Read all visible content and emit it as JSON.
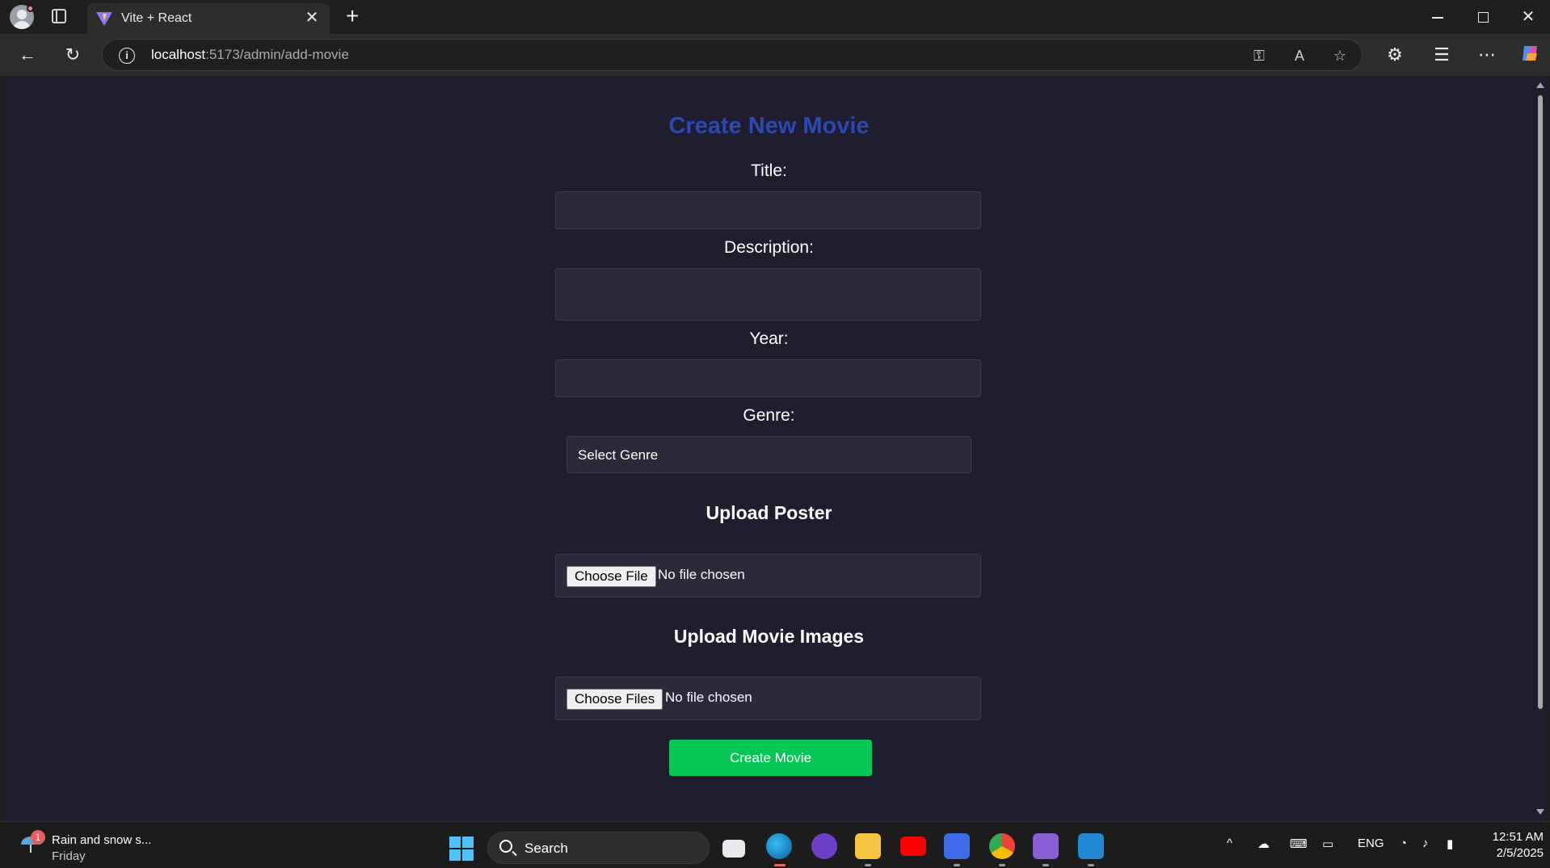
{
  "browser": {
    "tab_title": "Vite + React",
    "new_tab_symbol": "+",
    "address_host": "localhost",
    "address_path": ":5173/admin/add-movie"
  },
  "page": {
    "title": "Create New Movie",
    "labels": {
      "title": "Title:",
      "description": "Description:",
      "year": "Year:",
      "genre": "Genre:"
    },
    "title_value": "",
    "description_value": "",
    "year_value": "",
    "genre_selected": "Select Genre",
    "upload_poster_heading": "Upload Poster",
    "poster_button": "Choose File",
    "poster_status": "No file chosen",
    "upload_images_heading": "Upload Movie Images",
    "images_button": "Choose Files",
    "images_status": "No file chosen",
    "submit_label": "Create Movie"
  },
  "colors": {
    "page_background": "#1e1e2f",
    "title_color": "#2e49b4",
    "submit_color": "#06c755"
  },
  "taskbar": {
    "weather_badge": "1",
    "weather_line1": "Rain and snow s...",
    "weather_line2": "Friday",
    "search_label": "Search",
    "language": "ENG",
    "time": "12:51 AM",
    "date": "2/5/2025",
    "apps": [
      "task-view",
      "edge",
      "github-desktop",
      "file-explorer",
      "youtube",
      "analytics",
      "chrome",
      "visual-studio",
      "vscode"
    ]
  }
}
